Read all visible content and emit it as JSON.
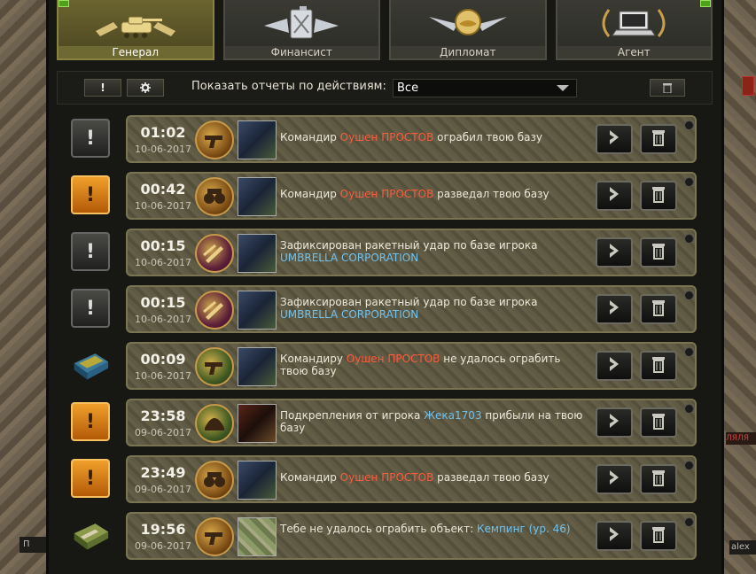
{
  "tabs": [
    {
      "label": "Генерал",
      "icon": "tank-emblem-icon",
      "active": true
    },
    {
      "label": "Финансист",
      "icon": "fuel-can-emblem-icon",
      "active": false
    },
    {
      "label": "Дипломат",
      "icon": "handshake-emblem-icon",
      "active": false
    },
    {
      "label": "Агент",
      "icon": "laptop-emblem-icon",
      "active": false
    }
  ],
  "filter": {
    "alert_label": "!",
    "settings_icon": "gear-icon",
    "label": "Показать отчеты по действиям:",
    "selected": "Все"
  },
  "side": {
    "left_label": "П",
    "right_label": "alex",
    "right_red_label": "ЛЯЛЯ"
  },
  "reports": [
    {
      "status": "grey",
      "time": "01:02",
      "date": "10-06-2017",
      "medal": "pistol-medal-icon",
      "medal_style": "gold",
      "avatar": "soldier-avatar",
      "pre": "Командир ",
      "name": "Оушен ПРОСТОВ",
      "name_color": "red",
      "post": " ограбил твою базу"
    },
    {
      "status": "orange",
      "time": "00:42",
      "date": "10-06-2017",
      "medal": "binoculars-medal-icon",
      "medal_style": "gold",
      "avatar": "soldier-avatar",
      "pre": "Командир ",
      "name": "Оушен ПРОСТОВ",
      "name_color": "red",
      "post": " разведал твою базу"
    },
    {
      "status": "grey",
      "time": "00:15",
      "date": "10-06-2017",
      "medal": "missile-medal-icon",
      "medal_style": "purple",
      "avatar": "soldier-avatar",
      "pre": "Зафиксирован ракетный удар по базе игрока ",
      "name": "UMBRELLA CORPORATION",
      "name_color": "blue",
      "post": ""
    },
    {
      "status": "grey",
      "time": "00:15",
      "date": "10-06-2017",
      "medal": "missile-medal-icon",
      "medal_style": "purple",
      "avatar": "soldier-avatar",
      "pre": "Зафиксирован ракетный удар по базе игрока ",
      "name": "UMBRELLA CORPORATION",
      "name_color": "blue",
      "post": ""
    },
    {
      "status": "box-blue",
      "time": "00:09",
      "date": "10-06-2017",
      "medal": "pistol-medal-icon",
      "medal_style": "green",
      "avatar": "soldier-avatar",
      "pre": "Командиру ",
      "name": "Оушен ПРОСТОВ",
      "name_color": "red",
      "post": " не удалось ограбить твою базу"
    },
    {
      "status": "orange",
      "time": "23:58",
      "date": "09-06-2017",
      "medal": "helmet-medal-icon",
      "medal_style": "green",
      "avatar": "red-soldier-avatar",
      "pre": "Подкрепления от игрока ",
      "name": "Жека1703",
      "name_color": "blue",
      "post": " прибыли на твою базу"
    },
    {
      "status": "orange",
      "time": "23:49",
      "date": "09-06-2017",
      "medal": "binoculars-medal-icon",
      "medal_style": "gold",
      "avatar": "soldier-avatar",
      "pre": "Командир ",
      "name": "Оушен ПРОСТОВ",
      "name_color": "red",
      "post": " разведал твою базу"
    },
    {
      "status": "box-green",
      "time": "19:56",
      "date": "09-06-2017",
      "medal": "pistol-medal-icon",
      "medal_style": "gold",
      "avatar": "map-avatar",
      "pre": "Тебе не удалось ограбить объект: ",
      "name": "Кемпинг (ур. 46)",
      "name_color": "blue",
      "post": ""
    }
  ]
}
